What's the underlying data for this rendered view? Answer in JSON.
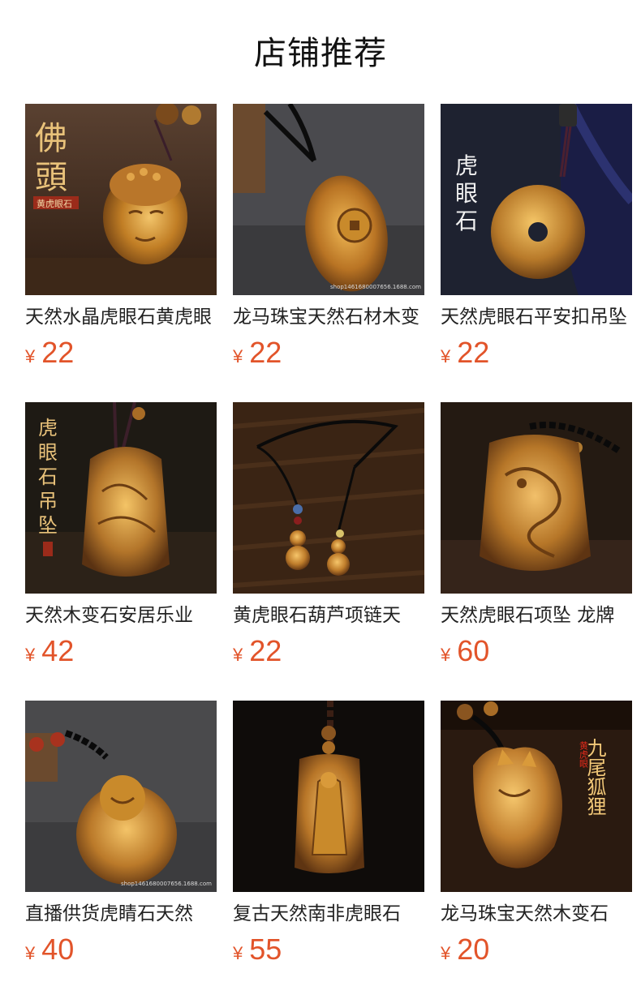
{
  "title": "店铺推荐",
  "currency_symbol": "¥",
  "colors": {
    "price": "#e2542a",
    "amber": "#c98a2b",
    "gold_text": "#e9c27a"
  },
  "products": [
    {
      "name": "天然水晶虎眼石黄虎眼",
      "price": "22",
      "image_text": [
        "佛",
        "頭",
        "黄虎眼石"
      ],
      "image_desc": "buddha-head-pendant-icon"
    },
    {
      "name": "龙马珠宝天然石材木变",
      "price": "22",
      "image_text": [],
      "image_desc": "coin-toad-pendant-icon"
    },
    {
      "name": "天然虎眼石平安扣吊坠",
      "price": "22",
      "image_text": [
        "虎",
        "眼",
        "石"
      ],
      "image_desc": "safety-buckle-pendant-icon"
    },
    {
      "name": "天然木变石安居乐业",
      "price": "42",
      "image_text": [
        "虎",
        "眼",
        "石",
        "吊",
        "坠"
      ],
      "image_desc": "landscape-pendant-icon"
    },
    {
      "name": "黄虎眼石葫芦项链天",
      "price": "22",
      "image_text": [],
      "image_desc": "gourd-necklace-icon"
    },
    {
      "name": "天然虎眼石项坠 龙牌",
      "price": "60",
      "image_text": [],
      "image_desc": "dragon-plaque-pendant-icon"
    },
    {
      "name": "直播供货虎睛石天然",
      "price": "40",
      "image_text": [],
      "image_desc": "laughing-buddha-pendant-icon"
    },
    {
      "name": "复古天然南非虎眼石",
      "price": "55",
      "image_text": [],
      "image_desc": "guanyin-plaque-pendant-icon"
    },
    {
      "name": "龙马珠宝天然木变石",
      "price": "20",
      "image_text": [
        "九尾狐狸",
        "黄虎眼"
      ],
      "image_desc": "nine-tail-fox-pendant-icon"
    }
  ]
}
